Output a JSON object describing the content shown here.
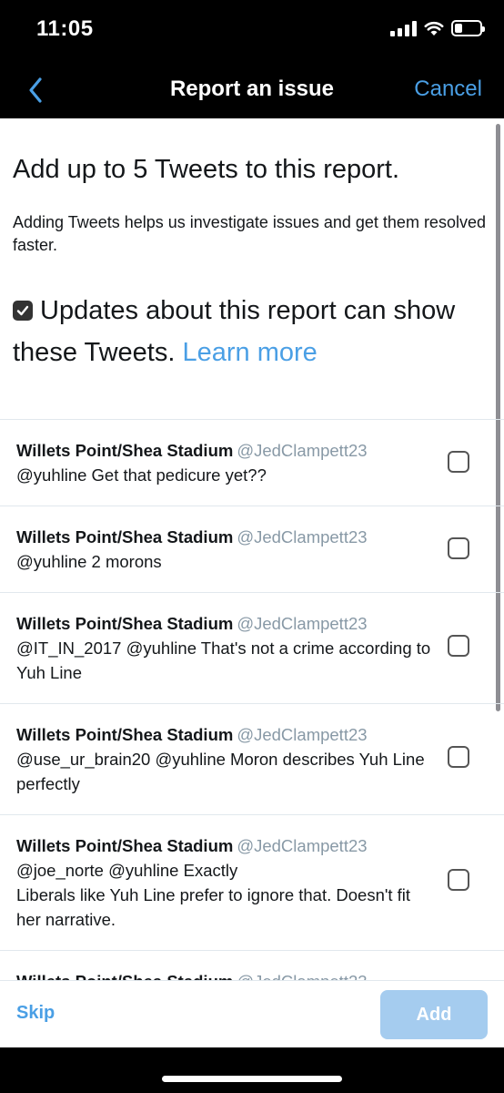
{
  "status_bar": {
    "time": "11:05"
  },
  "nav": {
    "title": "Report an issue",
    "cancel_label": "Cancel"
  },
  "content": {
    "headline": "Add up to 5 Tweets to this report.",
    "subtext": "Adding Tweets helps us investigate issues and get them resolved faster.",
    "updates_text": "Updates about this report can show these Tweets.",
    "learn_more": "Learn more",
    "updates_checked": true
  },
  "tweets": [
    {
      "name": "Willets Point/Shea Stadium",
      "handle": "@JedClampett23",
      "text": "@yuhline Get that pedicure yet??"
    },
    {
      "name": "Willets Point/Shea Stadium",
      "handle": "@JedClampett23",
      "text": "@yuhline 2 morons"
    },
    {
      "name": "Willets Point/Shea Stadium",
      "handle": "@JedClampett23",
      "text": "@IT_IN_2017 @yuhline That's not a crime according to Yuh Line"
    },
    {
      "name": "Willets Point/Shea Stadium",
      "handle": "@JedClampett23",
      "text": "@use_ur_brain20 @yuhline Moron describes Yuh Line perfectly"
    },
    {
      "name": "Willets Point/Shea Stadium",
      "handle": "@JedClampett23",
      "text": "@joe_norte @yuhline Exactly\nLiberals like Yuh Line prefer to ignore that. Doesn't fit her narrative."
    },
    {
      "name": "Willets Point/Shea Stadium",
      "handle": "@JedClampett23",
      "text": ""
    }
  ],
  "footer": {
    "skip_label": "Skip",
    "add_label": "Add"
  },
  "colors": {
    "accent": "#4a9fe5",
    "add_disabled": "#a5ccef",
    "handle": "#8899a6"
  }
}
